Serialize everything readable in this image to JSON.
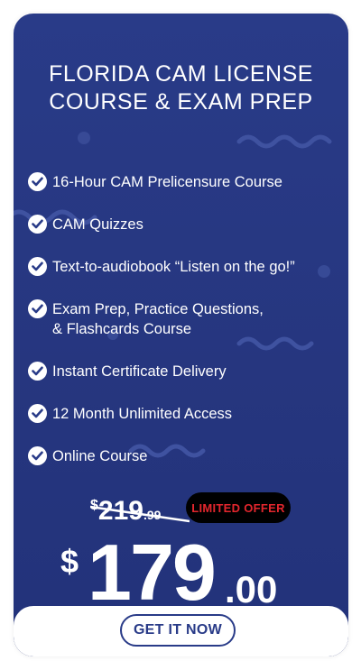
{
  "colors": {
    "card_background": "#293b88",
    "text": "#ffffff",
    "badge_background": "#000000",
    "badge_text": "#e3262d",
    "button_border": "#293b88",
    "button_text": "#293b88"
  },
  "header": {
    "title_line1": "FLORIDA CAM LICENSE",
    "title_line2": "COURSE & EXAM PREP"
  },
  "features": [
    {
      "icon": "check-circle-icon",
      "text": "16-Hour CAM Prelicensure Course"
    },
    {
      "icon": "check-circle-icon",
      "text": "CAM Quizzes"
    },
    {
      "icon": "check-circle-icon",
      "text": "Text-to-audiobook “Listen on the go!”"
    },
    {
      "icon": "check-circle-icon",
      "text": "Exam Prep, Practice Questions,\n& Flashcards Course"
    },
    {
      "icon": "check-circle-icon",
      "text": "Instant Certificate Delivery"
    },
    {
      "icon": "check-circle-icon",
      "text": "12 Month Unlimited Access"
    },
    {
      "icon": "check-circle-icon",
      "text": "Online Course"
    }
  ],
  "pricing": {
    "old_currency": "$",
    "old_integer": "219",
    "old_decimal": ".99",
    "badge": "LIMITED OFFER",
    "currency": "$",
    "integer": "179",
    "decimal": ".00"
  },
  "cta": {
    "label": "GET IT NOW"
  }
}
